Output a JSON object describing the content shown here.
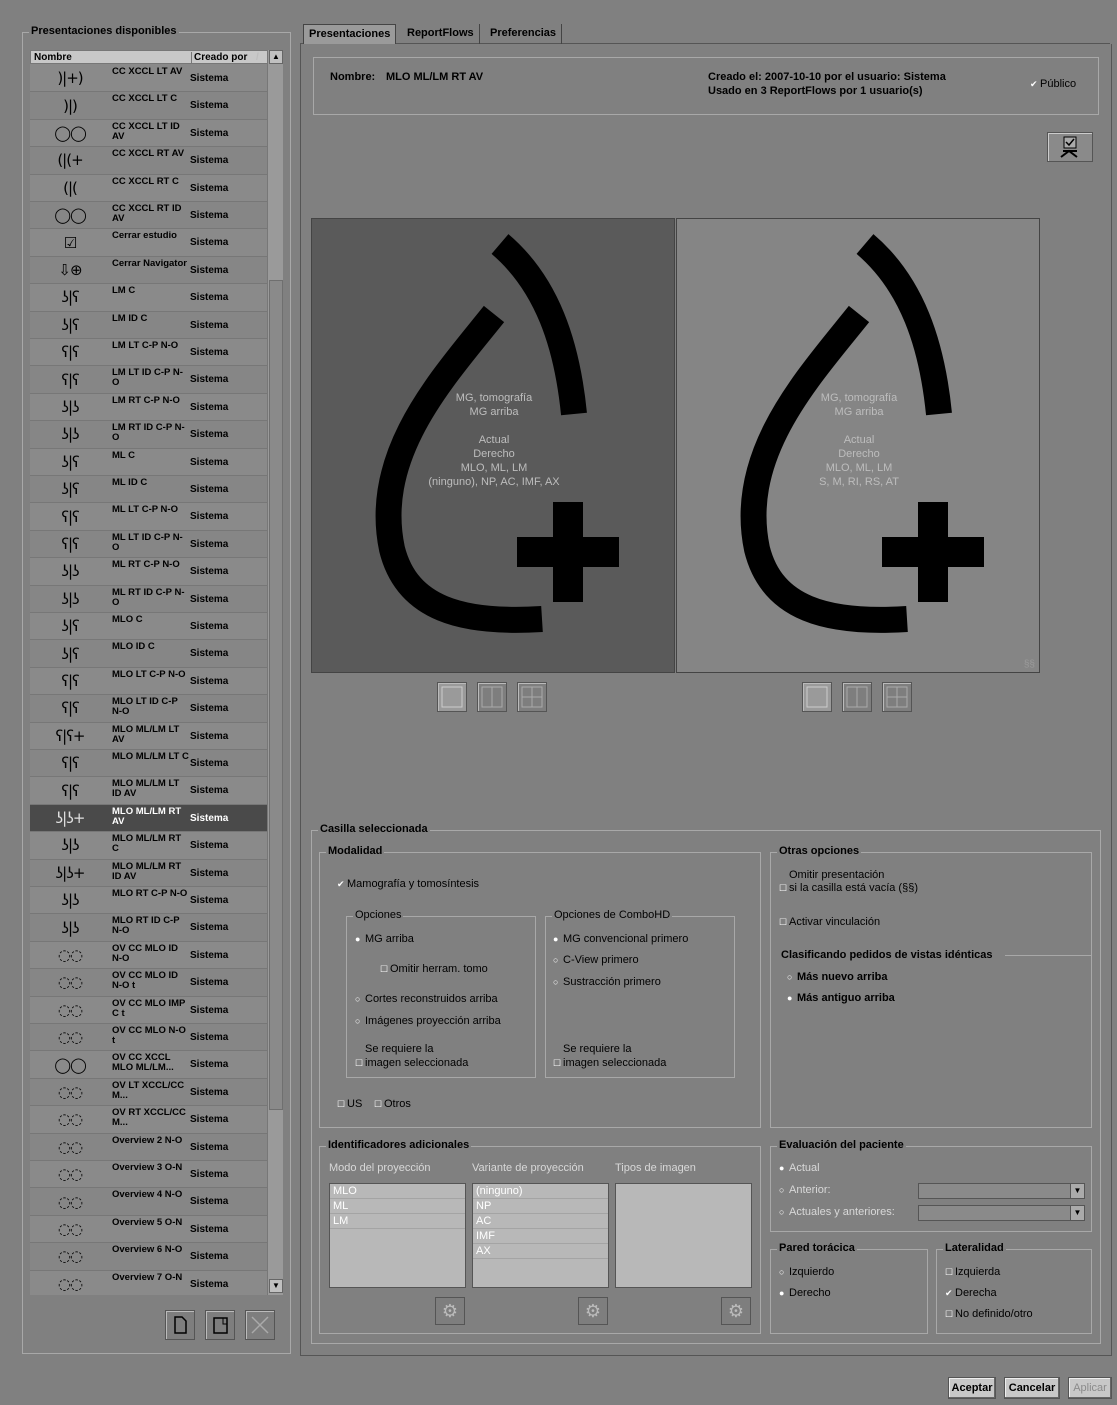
{
  "left_panel": {
    "title": "Presentaciones disponibles",
    "col_name": "Nombre",
    "col_created": "Creado por",
    "sort_indicator": "/",
    "scroll_up": "▲",
    "scroll_down": "▼",
    "rows": [
      {
        "icon": ")|+)",
        "name": "CC XCCL LT AV",
        "created": "Sistema"
      },
      {
        "icon": ")|)",
        "name": "CC XCCL LT C",
        "created": "Sistema"
      },
      {
        "icon": "◯◯",
        "name": "CC XCCL LT ID AV",
        "created": "Sistema"
      },
      {
        "icon": "(|(+",
        "name": "CC XCCL RT AV",
        "created": "Sistema"
      },
      {
        "icon": "(|(",
        "name": "CC XCCL RT C",
        "created": "Sistema"
      },
      {
        "icon": "◯◯",
        "name": "CC XCCL RT ID AV",
        "created": "Sistema"
      },
      {
        "icon": "☑",
        "name": "Cerrar estudio",
        "created": "Sistema"
      },
      {
        "icon": "⇩⊕",
        "name": "Cerrar Navigator",
        "created": "Sistema"
      },
      {
        "icon": "ʖ|ʕ",
        "name": "LM C",
        "created": "Sistema"
      },
      {
        "icon": "ʖ|ʕ",
        "name": "LM ID C",
        "created": "Sistema"
      },
      {
        "icon": "ʕ|ʕ",
        "name": "LM LT C-P N-O",
        "created": "Sistema"
      },
      {
        "icon": "ʕ|ʕ",
        "name": "LM LT ID C-P N-O",
        "created": "Sistema"
      },
      {
        "icon": "ʖ|ʖ",
        "name": "LM RT C-P N-O",
        "created": "Sistema"
      },
      {
        "icon": "ʖ|ʖ",
        "name": "LM RT ID C-P N-O",
        "created": "Sistema"
      },
      {
        "icon": "ʖ|ʕ",
        "name": "ML C",
        "created": "Sistema"
      },
      {
        "icon": "ʖ|ʕ",
        "name": "ML ID C",
        "created": "Sistema"
      },
      {
        "icon": "ʕ|ʕ",
        "name": "ML LT C-P N-O",
        "created": "Sistema"
      },
      {
        "icon": "ʕ|ʕ",
        "name": "ML LT ID C-P N-O",
        "created": "Sistema"
      },
      {
        "icon": "ʖ|ʖ",
        "name": "ML RT C-P N-O",
        "created": "Sistema"
      },
      {
        "icon": "ʖ|ʖ",
        "name": "ML RT ID C-P N-O",
        "created": "Sistema"
      },
      {
        "icon": "ʖ|ʕ",
        "name": "MLO C",
        "created": "Sistema"
      },
      {
        "icon": "ʖ|ʕ",
        "name": "MLO ID C",
        "created": "Sistema"
      },
      {
        "icon": "ʕ|ʕ",
        "name": "MLO LT C-P N-O",
        "created": "Sistema"
      },
      {
        "icon": "ʕ|ʕ",
        "name": "MLO LT ID C-P N-O",
        "created": "Sistema"
      },
      {
        "icon": "ʕ|ʕ+",
        "name": "MLO ML/LM LT AV",
        "created": "Sistema"
      },
      {
        "icon": "ʕ|ʕ",
        "name": "MLO ML/LM LT C",
        "created": "Sistema"
      },
      {
        "icon": "ʕ|ʕ",
        "name": "MLO ML/LM LT ID AV",
        "created": "Sistema"
      },
      {
        "icon": "ʖ|ʖ+",
        "name": "MLO ML/LM RT AV",
        "created": "Sistema",
        "selected": true
      },
      {
        "icon": "ʖ|ʖ",
        "name": "MLO ML/LM RT C",
        "created": "Sistema"
      },
      {
        "icon": "ʖ|ʖ+",
        "name": "MLO ML/LM RT ID AV",
        "created": "Sistema"
      },
      {
        "icon": "ʖ|ʖ",
        "name": "MLO RT C-P N-O",
        "created": "Sistema"
      },
      {
        "icon": "ʖ|ʖ",
        "name": "MLO RT ID C-P N-O",
        "created": "Sistema"
      },
      {
        "icon": "◌◌",
        "name": "OV CC MLO ID N-O",
        "created": "Sistema"
      },
      {
        "icon": "◌◌",
        "name": "OV CC MLO ID N-O t",
        "created": "Sistema"
      },
      {
        "icon": "◌◌",
        "name": "OV CC MLO IMP C t",
        "created": "Sistema"
      },
      {
        "icon": "◌◌",
        "name": "OV CC MLO N-O t",
        "created": "Sistema"
      },
      {
        "icon": "◯◯",
        "name": "OV CC XCCL MLO ML/LM...",
        "created": "Sistema"
      },
      {
        "icon": "◌◌",
        "name": "OV LT XCCL/CC M...",
        "created": "Sistema"
      },
      {
        "icon": "◌◌",
        "name": "OV RT XCCL/CC M...",
        "created": "Sistema"
      },
      {
        "icon": "◌◌",
        "name": "Overview 2 N-O",
        "created": "Sistema"
      },
      {
        "icon": "◌◌",
        "name": "Overview 3 O-N",
        "created": "Sistema"
      },
      {
        "icon": "◌◌",
        "name": "Overview 4 N-O",
        "created": "Sistema"
      },
      {
        "icon": "◌◌",
        "name": "Overview 5 O-N",
        "created": "Sistema"
      },
      {
        "icon": "◌◌",
        "name": "Overview 6 N-O",
        "created": "Sistema"
      },
      {
        "icon": "◌◌",
        "name": "Overview 7 O-N",
        "created": "Sistema"
      }
    ]
  },
  "tabs": [
    "Presentaciones",
    "ReportFlows",
    "Preferencias"
  ],
  "info": {
    "name_label": "Nombre:",
    "name_value": "MLO ML/LM RT AV",
    "created": "Creado el: 2007-10-10 por el usuario: Sistema",
    "used": "Usado en 3 ReportFlows por 1 usuario(s)",
    "public_label": "Público"
  },
  "viewports": [
    {
      "lines": [
        "MG, tomografía",
        "MG arriba",
        "",
        "Actual",
        "Derecho",
        "MLO, ML, LM",
        "(ninguno), NP, AC, IMF, AX"
      ]
    },
    {
      "lines": [
        "MG, tomografía",
        "MG arriba",
        "",
        "Actual",
        "Derecho",
        "MLO, ML, LM",
        "S, M, RI, RS, AT"
      ],
      "corner": "§§"
    }
  ],
  "casilla": {
    "title": "Casilla seleccionada",
    "modalidad": "Modalidad",
    "mamografia": "Mamografía y tomosíntesis",
    "opciones": "Opciones",
    "mg_arriba": "MG arriba",
    "omitir_tomo": "Omitir herram. tomo",
    "cortes": "Cortes reconstruidos arriba",
    "imagenes": "Imágenes proyección arriba",
    "requiere1": "Se requiere la",
    "requiere2": "imagen seleccionada",
    "combohd": "Opciones de ComboHD",
    "mg_conv": "MG convencional primero",
    "cview": "C-View primero",
    "sustr": "Sustracción primero",
    "us": "US",
    "otros": "Otros"
  },
  "otras": {
    "title": "Otras opciones",
    "omitir1": "Omitir presentación",
    "omitir2": "si la casilla está vacía (§§)",
    "vinc": "Activar vinculación",
    "clasif": "Clasificando pedidos de vistas idénticas",
    "nuevo": "Más nuevo arriba",
    "antiguo": "Más antiguo arriba"
  },
  "ident": {
    "title": "Identificadores adicionales",
    "modo": "Modo del proyección",
    "variante": "Variante de proyección",
    "tipos": "Tipos de imagen",
    "modo_items": [
      "MLO",
      "ML",
      "LM"
    ],
    "variante_items": [
      "(ninguno)",
      "NP",
      "AC",
      "IMF",
      "AX"
    ]
  },
  "eval": {
    "title": "Evaluación del paciente",
    "actual": "Actual",
    "anterior": "Anterior:",
    "actuales": "Actuales y anteriores:"
  },
  "pared": {
    "title": "Pared torácica",
    "izq": "Izquierdo",
    "der": "Derecho"
  },
  "lat": {
    "title": "Lateralidad",
    "izq": "Izquierda",
    "der": "Derecha",
    "nd": "No definido/otro"
  },
  "footer": {
    "ok": "Aceptar",
    "cancel": "Cancelar",
    "apply": "Aplicar"
  }
}
